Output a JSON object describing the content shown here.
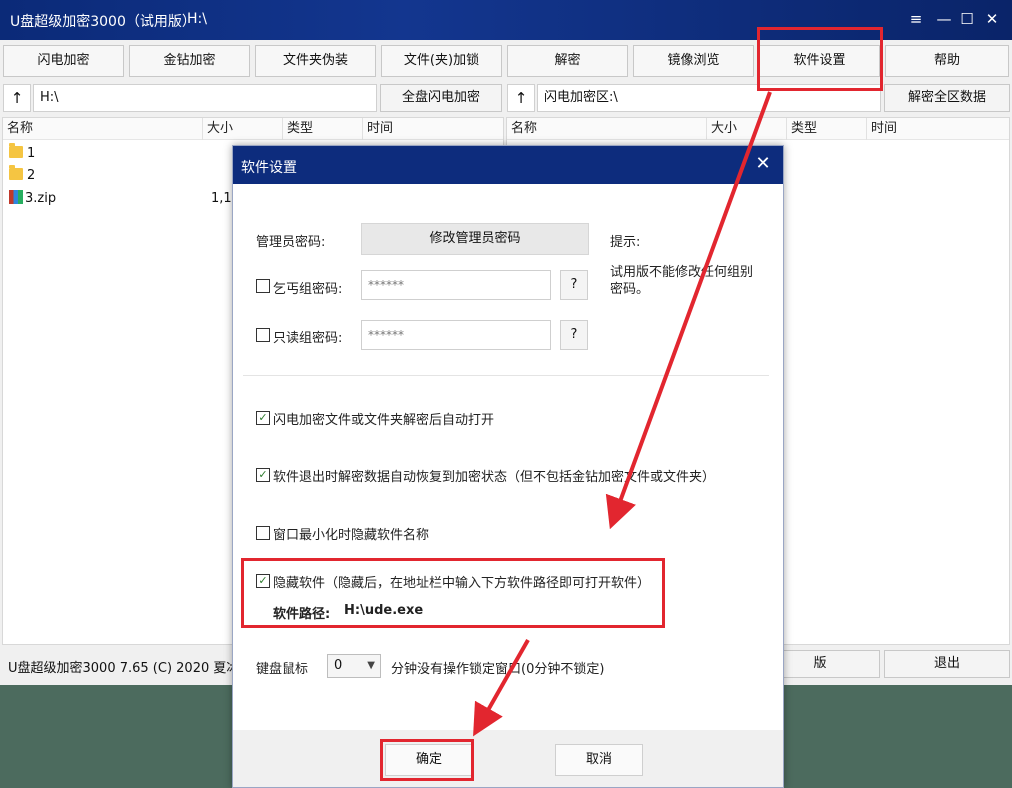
{
  "window": {
    "title": "U盘超级加密3000（试用版）",
    "path": "H:\\"
  },
  "window_controls": {
    "menu": "≡",
    "minimize": "—",
    "maximize": "☐",
    "close": "✕"
  },
  "toolbar": [
    "闪电加密",
    "金钻加密",
    "文件夹伪装",
    "文件(夹)加锁",
    "解密",
    "镜像浏览",
    "软件设置",
    "帮助"
  ],
  "left_pane": {
    "address": "H:\\",
    "action": "全盘闪电加密",
    "columns": [
      "名称",
      "大小",
      "类型",
      "时间"
    ],
    "files": [
      {
        "name": "1",
        "size": "",
        "kind": "folder"
      },
      {
        "name": "2",
        "size": "",
        "kind": "folder"
      },
      {
        "name": "3.zip",
        "size": "1,1",
        "kind": "zip"
      }
    ]
  },
  "right_pane": {
    "address": "闪电加密区:\\",
    "action": "解密全区数据",
    "columns": [
      "名称",
      "大小",
      "类型",
      "时间"
    ]
  },
  "statusbar": {
    "text": "U盘超级加密3000 7.65 (C) 2020 夏冰",
    "hidden_btn": "版",
    "exit": "退出"
  },
  "dialog": {
    "title": "软件设置",
    "admin_label": "管理员密码:",
    "admin_btn": "修改管理员密码",
    "hint_title": "提示:",
    "hint_text": "试用版不能修改任何组别密码。",
    "beggar_label": "乞丐组密码:",
    "beggar_value": "******",
    "readonly_label": "只读组密码:",
    "readonly_value": "******",
    "help": "?",
    "options": [
      {
        "label": "闪电加密文件或文件夹解密后自动打开",
        "checked": true
      },
      {
        "label": "软件退出时解密数据自动恢复到加密状态（但不包括金钻加密文件或文件夹）",
        "checked": true
      },
      {
        "label": "窗口最小化时隐藏软件名称",
        "checked": false
      },
      {
        "label": "隐藏软件（隐藏后，在地址栏中输入下方软件路径即可打开软件）",
        "checked": true
      }
    ],
    "software_path_label": "软件路径:",
    "software_path": "H:\\ude.exe",
    "lock_label": "键盘鼠标",
    "lock_value": "0",
    "lock_suffix": "分钟没有操作锁定窗口(0分钟不锁定)",
    "ok": "确定",
    "cancel": "取消"
  },
  "annotation_color": "#e2262f"
}
